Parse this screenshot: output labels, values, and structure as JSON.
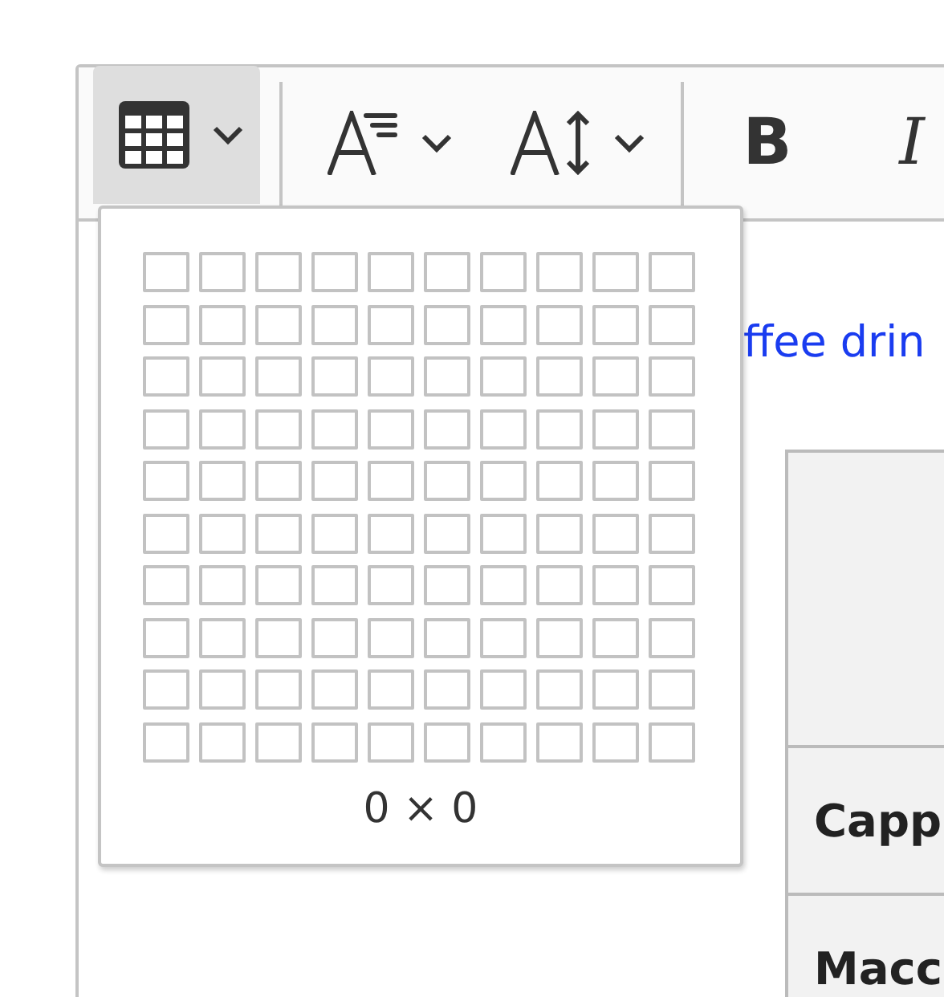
{
  "toolbar": [
    {
      "kind": "table",
      "open": true
    },
    {
      "kind": "font-size",
      "open": false
    },
    {
      "kind": "line-height",
      "open": false
    },
    {
      "kind": "bold",
      "label": "B"
    },
    {
      "kind": "italic",
      "label": "I"
    }
  ],
  "table_picker": {
    "size_label": "0 × 0"
  },
  "content": {
    "link_text": "ffee drin",
    "table": {
      "rows": [
        {
          "kind": "header"
        },
        {
          "kind": "body",
          "cell": "Capp"
        },
        {
          "kind": "body",
          "cell": "Macc"
        }
      ]
    }
  }
}
